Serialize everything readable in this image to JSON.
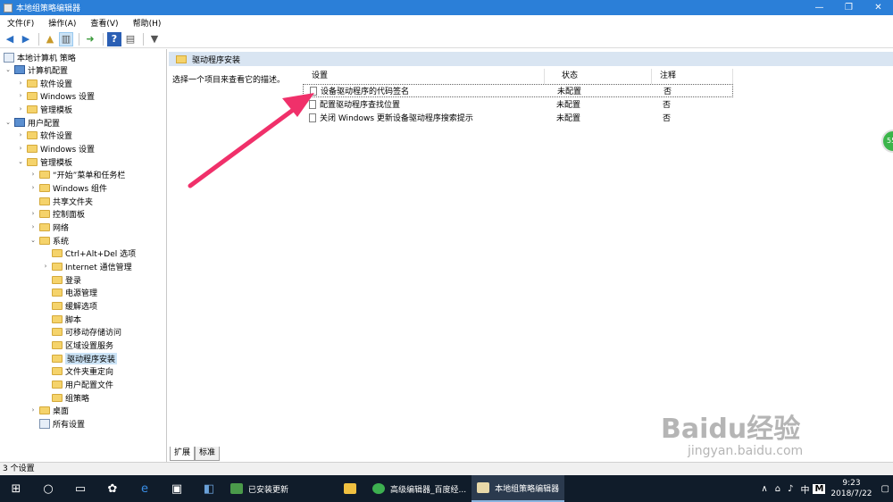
{
  "window": {
    "title": "本地组策略编辑器",
    "controls": {
      "minimize": "—",
      "maximize": "❐",
      "close": "✕"
    }
  },
  "menu": [
    "文件(F)",
    "操作(A)",
    "查看(V)",
    "帮助(H)"
  ],
  "tree": {
    "root": "本地计算机 策略",
    "computer_config": "计算机配置",
    "cc_software": "软件设置",
    "cc_windows": "Windows 设置",
    "cc_admin": "管理模板",
    "user_config": "用户配置",
    "uc_software": "软件设置",
    "uc_windows": "Windows 设置",
    "uc_admin": "管理模板",
    "start_taskbar": "“开始”菜单和任务栏",
    "windows_components": "Windows 组件",
    "shared_folders": "共享文件夹",
    "control_panel": "控制面板",
    "network": "网络",
    "system": "系统",
    "ctrl_alt_del": "Ctrl+Alt+Del 选项",
    "internet_comm": "Internet 通信管理",
    "logon": "登录",
    "power": "电源管理",
    "mitigation": "缓解选项",
    "scripts": "脚本",
    "removable_storage": "可移动存储访问",
    "locale_services": "区域设置服务",
    "driver_install": "驱动程序安装",
    "folder_redirection": "文件夹重定向",
    "user_profiles": "用户配置文件",
    "group_policy": "组策略",
    "desktop": "桌面",
    "all_settings": "所有设置"
  },
  "right": {
    "header": "驱动程序安装",
    "description": "选择一个项目来查看它的描述。",
    "columns": {
      "setting": "设置",
      "state": "状态",
      "note": "注释"
    },
    "rows": [
      {
        "name": "设备驱动程序的代码签名",
        "state": "未配置",
        "note": "否"
      },
      {
        "name": "配置驱动程序查找位置",
        "state": "未配置",
        "note": "否"
      },
      {
        "name": "关闭 Windows 更新设备驱动程序搜索提示",
        "state": "未配置",
        "note": "否"
      }
    ]
  },
  "tabs": {
    "extended": "扩展",
    "standard": "标准"
  },
  "status": "3 个设置",
  "side_badge": "55",
  "watermark": {
    "logo": "Baidu经验",
    "url": "jingyan.baidu.com"
  },
  "taskbar": {
    "apps": [
      {
        "label": "已安装更新"
      },
      {
        "label": ""
      },
      {
        "label": "高级编辑器_百度经..."
      },
      {
        "label": "本地组策略编辑器"
      }
    ],
    "ime": "中",
    "ime2": "M",
    "time": "9:23",
    "date": "2018/7/22"
  },
  "colors": {
    "title_bar": "#2b7fd8",
    "header_band": "#d9e5f2",
    "arrow": "#f0306a",
    "taskbar": "#101c2a"
  }
}
